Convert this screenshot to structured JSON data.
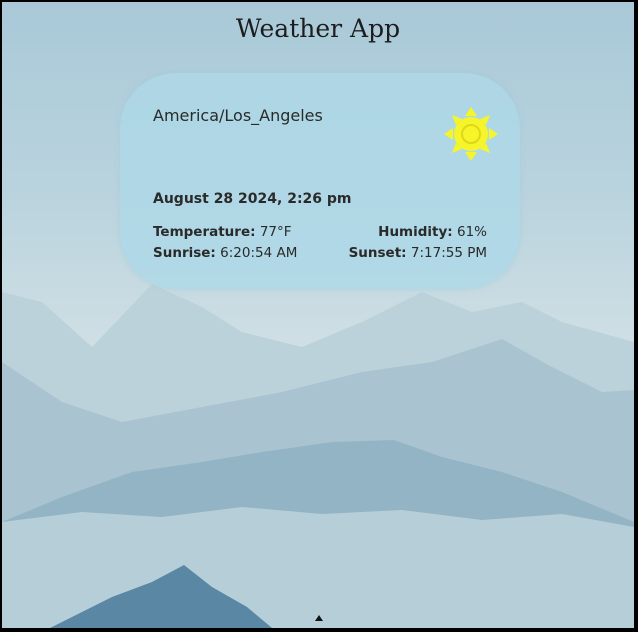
{
  "app": {
    "title": "Weather App"
  },
  "weather_card": {
    "location": "America/Los_Angeles",
    "datetime": "August 28 2024, 2:26 pm",
    "icon": "sun-icon",
    "temperature_label": "Temperature:",
    "temperature_value": "77°F",
    "humidity_label": "Humidity:",
    "humidity_value": "61%",
    "sunrise_label": "Sunrise:",
    "sunrise_value": "6:20:54 AM",
    "sunset_label": "Sunset:",
    "sunset_value": "7:17:55 PM"
  },
  "colors": {
    "card_bg": "#add8e6",
    "sun": "#f5f52a",
    "sky_top": "#a9c9d8",
    "mountain_near": "#5a87a4"
  },
  "scroll_indicator": "triangle-up-icon"
}
